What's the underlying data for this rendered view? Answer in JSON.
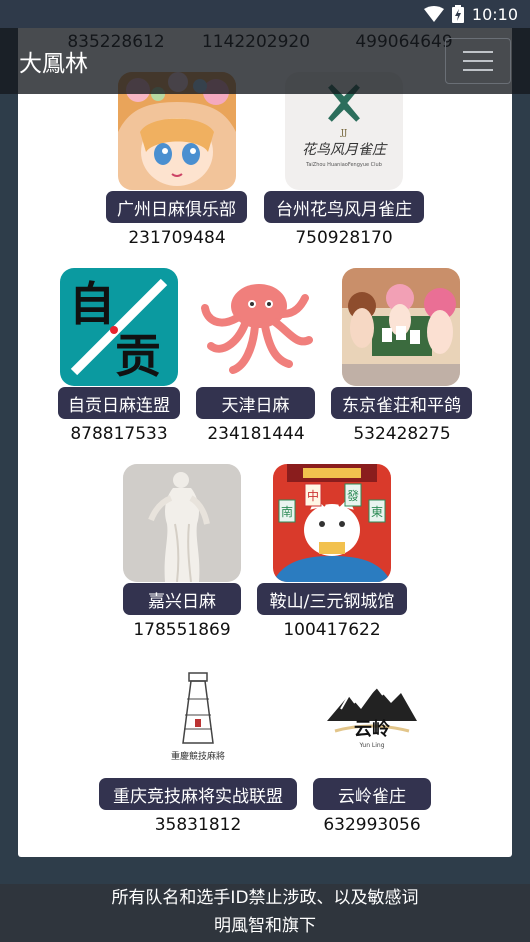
{
  "status": {
    "time": "10:10"
  },
  "app": {
    "title": "大鳳林"
  },
  "top_ids": [
    "835228612",
    "1142202920",
    "499064649"
  ],
  "clubs": [
    {
      "name": "广州日麻俱乐部",
      "id": "231709484",
      "icon": "anime-girl-avatar"
    },
    {
      "name": "台州花鸟风月雀庄",
      "id": "750928170",
      "icon": "calligraphy-logo",
      "logo_text": "花鸟风月雀庄",
      "logo_sub": "TaiZhou HuaniaoFengyue Club"
    },
    {
      "name": "自贡日麻连盟",
      "id": "878817533",
      "icon": "zigong-logo",
      "logo_text_top": "自",
      "logo_text_bottom": "贡"
    },
    {
      "name": "天津日麻",
      "id": "234181444",
      "icon": "octopus-icon"
    },
    {
      "name": "东京雀荘和平鸽",
      "id": "532428275",
      "icon": "anime-group-avatar"
    },
    {
      "name": "嘉兴日麻",
      "id": "178551869",
      "icon": "statue-photo"
    },
    {
      "name": "鞍山/三元钢城馆",
      "id": "100417622",
      "icon": "lucky-cat-icon",
      "logo_tiles": [
        "南",
        "中",
        "發",
        "東"
      ]
    },
    {
      "name": "重庆竞技麻将实战联盟",
      "id": "35831812",
      "icon": "tower-logo",
      "logo_text": "重慶競技麻將"
    },
    {
      "name": "云岭雀庄",
      "id": "632993056",
      "icon": "mountain-logo",
      "logo_text": "云岭",
      "logo_sub": "Yun Ling"
    }
  ],
  "footer": {
    "line1": "所有队名和选手ID禁止涉政、以及敏感词",
    "line2": "明風智和旗下"
  },
  "colors": {
    "label_bg": "#33334f",
    "appbar_bg": "#14181e",
    "page_bg": "#2e3d4a",
    "zigong_teal": "#0b9aa0"
  }
}
